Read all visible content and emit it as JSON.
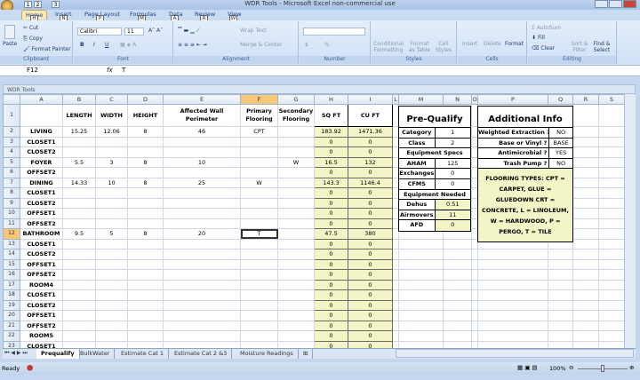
{
  "window": {
    "title": "WDR Tools - Microsoft Excel non-commercial use",
    "qat": [
      "1",
      "2",
      "3"
    ]
  },
  "ribbon": {
    "tabs": [
      {
        "label": "Home",
        "key": "H"
      },
      {
        "label": "Insert",
        "key": "N"
      },
      {
        "label": "Page Layout",
        "key": "P"
      },
      {
        "label": "Formulas",
        "key": "M"
      },
      {
        "label": "Data",
        "key": "A"
      },
      {
        "label": "Review",
        "key": "R"
      },
      {
        "label": "View",
        "key": "W"
      }
    ],
    "active_tab": "Home",
    "clipboard": {
      "label": "Clipboard",
      "paste": "Paste",
      "cut": "Cut",
      "copy": "Copy",
      "format_painter": "Format Painter"
    },
    "font": {
      "label": "Font",
      "name": "Calibri",
      "size": "11",
      "bold": "B",
      "italic": "I",
      "underline": "U"
    },
    "alignment": {
      "label": "Alignment",
      "wrap": "Wrap Text",
      "merge": "Merge & Center"
    },
    "number": {
      "label": "Number",
      "currency": "$",
      "percent": "%"
    },
    "styles": {
      "label": "Styles",
      "conditional": "Conditional Formatting",
      "format_table": "Format as Table",
      "cell_styles": "Cell Styles"
    },
    "cells": {
      "label": "Cells",
      "insert": "Insert",
      "delete": "Delete",
      "format": "Format"
    },
    "editing": {
      "label": "Editing",
      "autosum": "AutoSum",
      "fill": "Fill",
      "clear": "Clear",
      "sort": "Sort & Filter",
      "find": "Find & Select"
    }
  },
  "formula_bar": {
    "name_box": "F12",
    "fx": "fx",
    "value": "T"
  },
  "workbook": {
    "title": "WDR Tools"
  },
  "grid": {
    "columns": [
      "A",
      "B",
      "C",
      "D",
      "E",
      "F",
      "G",
      "H",
      "I",
      "L",
      "M",
      "N",
      "O",
      "P",
      "Q",
      "R",
      "S"
    ],
    "selected_column": "F",
    "selected_row": "12",
    "headers": [
      "",
      "LENGTH",
      "WIDTH",
      "HEIGHT",
      "Affected Wall Perimeter",
      "Primary Flooring",
      "Secondary Flooring",
      "SQ FT",
      "CU FT"
    ],
    "rows": [
      [
        "LIVING",
        "15.25",
        "12.06",
        "8",
        "46",
        "CPT",
        "",
        "183.92",
        "1471.36"
      ],
      [
        "CLOSET1",
        "",
        "",
        "",
        "",
        "",
        "",
        "0",
        "0"
      ],
      [
        "CLOSET2",
        "",
        "",
        "",
        "",
        "",
        "",
        "0",
        "0"
      ],
      [
        "FOYER",
        "5.5",
        "3",
        "8",
        "10",
        "",
        "W",
        "16.5",
        "132"
      ],
      [
        "OFFSET2",
        "",
        "",
        "",
        "",
        "",
        "",
        "0",
        "0"
      ],
      [
        "DINING",
        "14.33",
        "10",
        "8",
        "25",
        "W",
        "",
        "143.3",
        "1146.4"
      ],
      [
        "CLOSET1",
        "",
        "",
        "",
        "",
        "",
        "",
        "0",
        "0"
      ],
      [
        "CLOSET2",
        "",
        "",
        "",
        "",
        "",
        "",
        "0",
        "0"
      ],
      [
        "OFFSET1",
        "",
        "",
        "",
        "",
        "",
        "",
        "0",
        "0"
      ],
      [
        "OFFSET2",
        "",
        "",
        "",
        "",
        "",
        "",
        "0",
        "0"
      ],
      [
        "BATHROOM",
        "9.5",
        "5",
        "8",
        "20",
        "T",
        "",
        "47.5",
        "380"
      ],
      [
        "CLOSET1",
        "",
        "",
        "",
        "",
        "",
        "",
        "0",
        "0"
      ],
      [
        "CLOSET2",
        "",
        "",
        "",
        "",
        "",
        "",
        "0",
        "0"
      ],
      [
        "OFFSET1",
        "",
        "",
        "",
        "",
        "",
        "",
        "0",
        "0"
      ],
      [
        "OFFSET2",
        "",
        "",
        "",
        "",
        "",
        "",
        "0",
        "0"
      ],
      [
        "ROOM4",
        "",
        "",
        "",
        "",
        "",
        "",
        "0",
        "0"
      ],
      [
        "CLOSET1",
        "",
        "",
        "",
        "",
        "",
        "",
        "0",
        "0"
      ],
      [
        "CLOSET2",
        "",
        "",
        "",
        "",
        "",
        "",
        "0",
        "0"
      ],
      [
        "OFFSET1",
        "",
        "",
        "",
        "",
        "",
        "",
        "0",
        "0"
      ],
      [
        "OFFSET2",
        "",
        "",
        "",
        "",
        "",
        "",
        "0",
        "0"
      ],
      [
        "ROOM5",
        "",
        "",
        "",
        "",
        "",
        "",
        "0",
        "0"
      ],
      [
        "CLOSET1",
        "",
        "",
        "",
        "",
        "",
        "",
        "0",
        "0"
      ]
    ]
  },
  "prequalify": {
    "title": "Pre-Qualify",
    "category": {
      "label": "Category",
      "value": "1"
    },
    "class": {
      "label": "Class",
      "value": "2"
    },
    "equipment_specs": "Equipment Specs",
    "aham": {
      "label": "AHAM",
      "value": "125"
    },
    "exchanges": {
      "label": "Exchanges",
      "value": "0"
    },
    "cfms": {
      "label": "CFMS",
      "value": "0"
    },
    "equipment_needed": "Equipment Needed",
    "dehus": {
      "label": "Dehus",
      "value": "0.51"
    },
    "airmovers": {
      "label": "Airmovers",
      "value": "11"
    },
    "afd": {
      "label": "AFD",
      "value": "0"
    }
  },
  "additional_info": {
    "title": "Additional Info",
    "items": [
      {
        "label": "Weighted Extraction ?",
        "value": "NO"
      },
      {
        "label": "Base or Vinyl ?",
        "value": "BASE"
      },
      {
        "label": "Antimicrobial ?",
        "value": "YES"
      },
      {
        "label": "Trash Pump ?",
        "value": "NO"
      }
    ],
    "note": "FLOORING TYPES: CPT = CARPET, GLUE = GLUEDOWN CRT = CONCRETE, L = LINOLEUM, W = HARDWOOD, P = PERGO, T = TILE"
  },
  "sheet_tabs": [
    "Prequalify",
    "BulkWater",
    "Estimate Cat 1",
    "Estimate Cat 2 &3",
    "Moisture Readings"
  ],
  "active_sheet": "Prequalify",
  "status": {
    "text": "Ready",
    "zoom": "100%"
  },
  "colors": {
    "calc_fill": "#f3f5c7",
    "selection": "#f8c77a",
    "ribbon": "#dbe6f5"
  }
}
